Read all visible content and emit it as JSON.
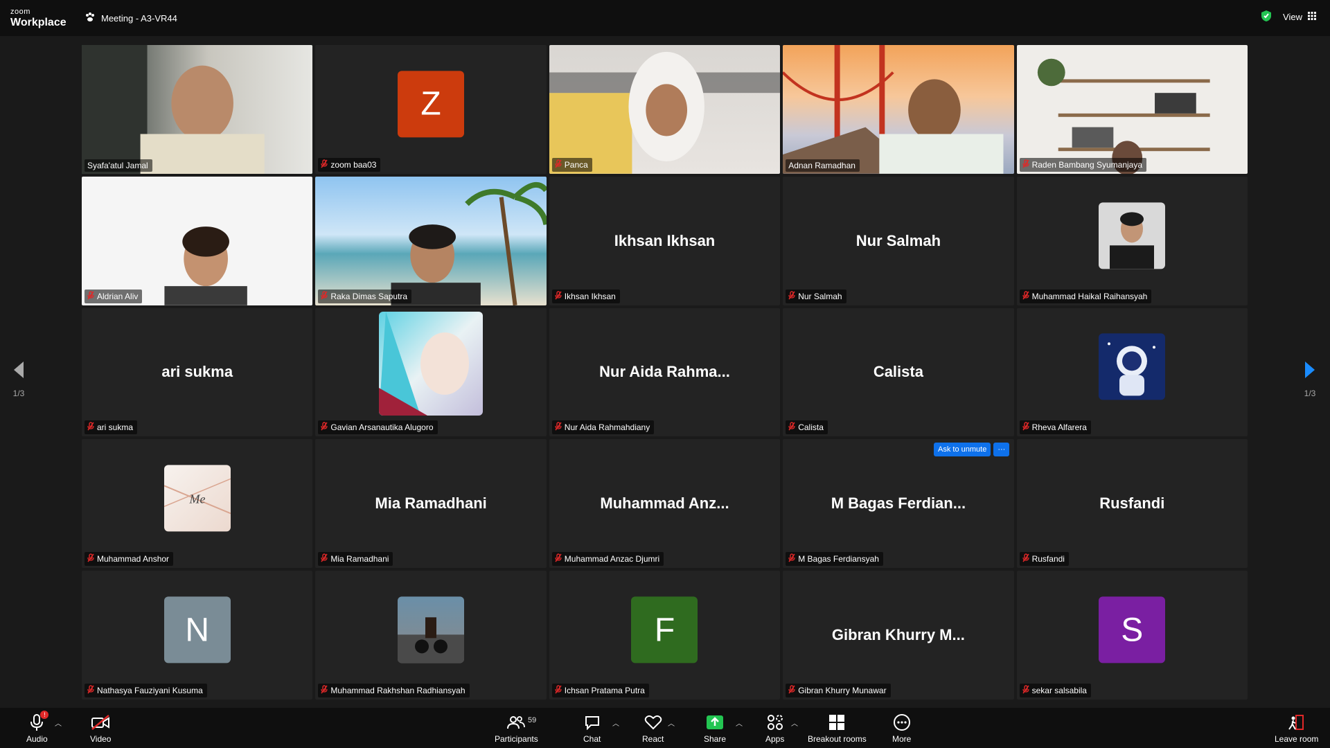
{
  "app": {
    "brand_small": "zoom",
    "brand_big": "Workplace",
    "meeting_title": "Meeting - A3-VR44",
    "view_label": "View"
  },
  "colors": {
    "active_border": "#2fd38b",
    "accent_blue": "#0e71eb",
    "mute_red": "#e02828"
  },
  "tiles": [
    {
      "name": "Syafa'atul Jamal",
      "type": "video",
      "active": true,
      "muted": false
    },
    {
      "name": "zoom baa03",
      "type": "letter",
      "letter": "Z",
      "color": "#cc3b0d",
      "muted": true
    },
    {
      "name": "Panca",
      "type": "video",
      "muted": true
    },
    {
      "name": "Adnan Ramadhan",
      "type": "video",
      "muted": false
    },
    {
      "name": "Raden Bambang Syumanjaya",
      "type": "video",
      "muted": true
    },
    {
      "name": "Aldrian Aliv",
      "type": "video",
      "muted": true
    },
    {
      "name": "Raka Dimas Saputra",
      "type": "video",
      "muted": true
    },
    {
      "name": "Ikhsan Ikhsan",
      "type": "text",
      "display": "Ikhsan Ikhsan",
      "muted": true
    },
    {
      "name": "Nur Salmah",
      "type": "text",
      "display": "Nur Salmah",
      "muted": true
    },
    {
      "name": "Muhammad Haikal Raihansyah",
      "type": "photo",
      "muted": true
    },
    {
      "name": "ari sukma",
      "type": "text",
      "display": "ari sukma",
      "muted": true
    },
    {
      "name": "Gavian Arsanautika Alugoro",
      "type": "photo-large",
      "muted": true
    },
    {
      "name": "Nur Aida Rahmahdiany",
      "type": "text",
      "display": "Nur Aida Rahma...",
      "muted": true
    },
    {
      "name": "Calista",
      "type": "text",
      "display": "Calista",
      "muted": true
    },
    {
      "name": "Rheva Alfarera",
      "type": "photo",
      "muted": true
    },
    {
      "name": "Muhammad Anshor",
      "type": "photo",
      "muted": true
    },
    {
      "name": "Mia Ramadhani",
      "type": "text",
      "display": "Mia Ramadhani",
      "muted": true
    },
    {
      "name": "Muhammad Anzac Djumri",
      "type": "text",
      "display": "Muhammad Anz...",
      "muted": true
    },
    {
      "name": "M Bagas Ferdiansyah",
      "type": "text",
      "display": "M Bagas Ferdian...",
      "muted": true
    },
    {
      "name": "Rusfandi",
      "type": "text",
      "display": "Rusfandi",
      "muted": true
    },
    {
      "name": "Nathasya Fauziyani Kusuma",
      "type": "letter",
      "letter": "N",
      "color": "#7a8c96",
      "muted": true
    },
    {
      "name": "Muhammad Rakhshan Radhiansyah",
      "type": "photo",
      "muted": true
    },
    {
      "name": "Ichsan Pratama Putra",
      "type": "letter",
      "letter": "F",
      "color": "#2f6b1f",
      "muted": true
    },
    {
      "name": "Gibran Khurry Munawar",
      "type": "text",
      "display": "Gibran Khurry M...",
      "muted": true
    },
    {
      "name": "sekar salsabila",
      "type": "letter",
      "letter": "S",
      "color": "#7a1fa2",
      "muted": true
    }
  ],
  "ask_unmute": {
    "label": "Ask to unmute",
    "more": "···"
  },
  "pagination": {
    "left": "1/3",
    "right": "1/3"
  },
  "toolbar": {
    "audio": "Audio",
    "video": "Video",
    "participants": "Participants",
    "participants_count": "59",
    "chat": "Chat",
    "react": "React",
    "share": "Share",
    "apps": "Apps",
    "breakout": "Breakout rooms",
    "more": "More",
    "leave": "Leave room",
    "mic_badge": "!"
  }
}
